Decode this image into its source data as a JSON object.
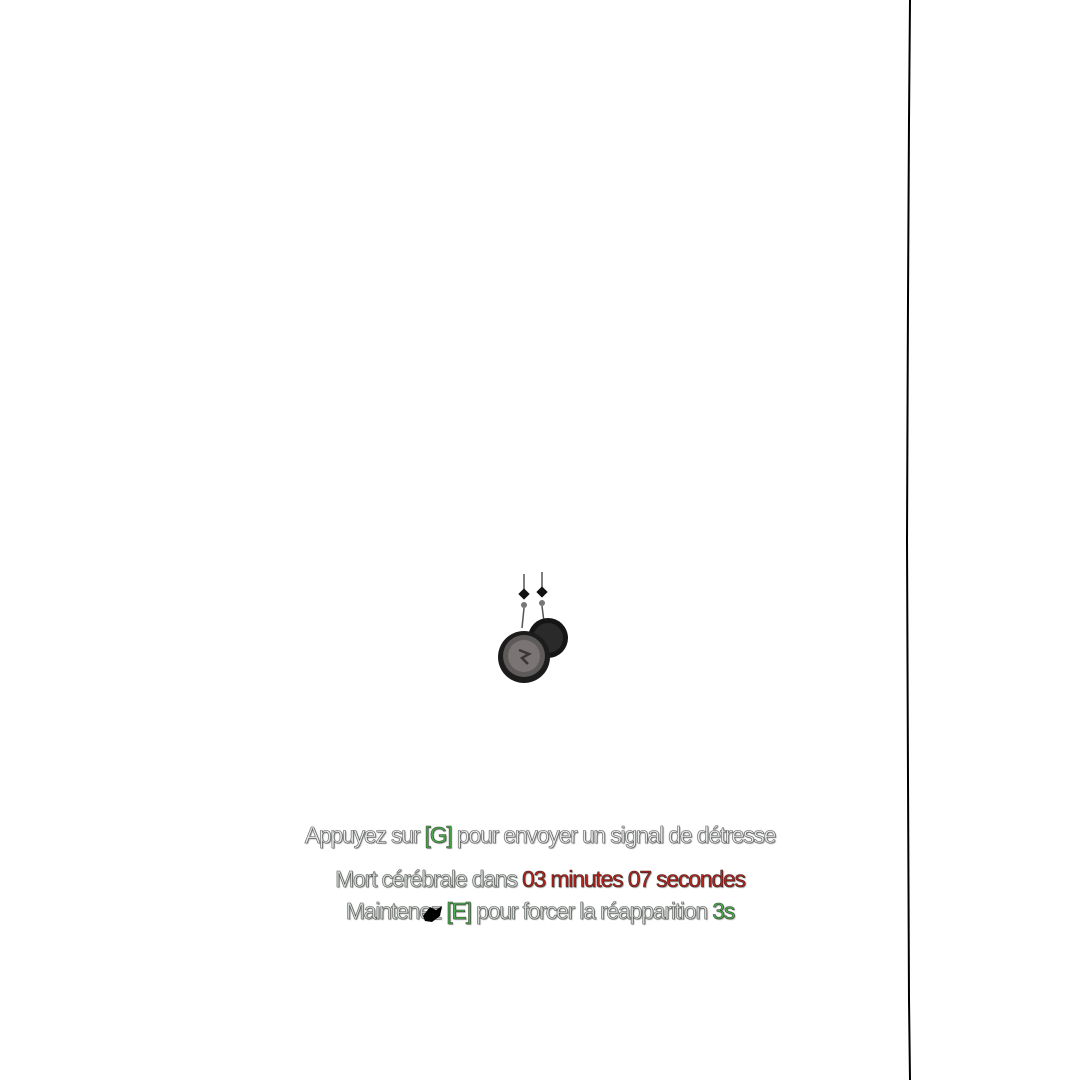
{
  "hud": {
    "distress": {
      "prefix": "Appuyez sur ",
      "key": "[G]",
      "suffix": " pour envoyer un signal de détresse"
    },
    "brain_death": {
      "prefix": "Mort cérébrale dans ",
      "time": "03 minutes 07 secondes"
    },
    "respawn": {
      "prefix": "Maintenez ",
      "key": "[E]",
      "middle": " pour forcer la réapparition ",
      "seconds": "3s"
    }
  },
  "colors": {
    "key_green": "#4fb04f",
    "timer_red": "#b3261e",
    "text_light": "#e9ecea"
  },
  "icons": [
    "hanging-prop-icon",
    "cursor-blob-icon"
  ]
}
